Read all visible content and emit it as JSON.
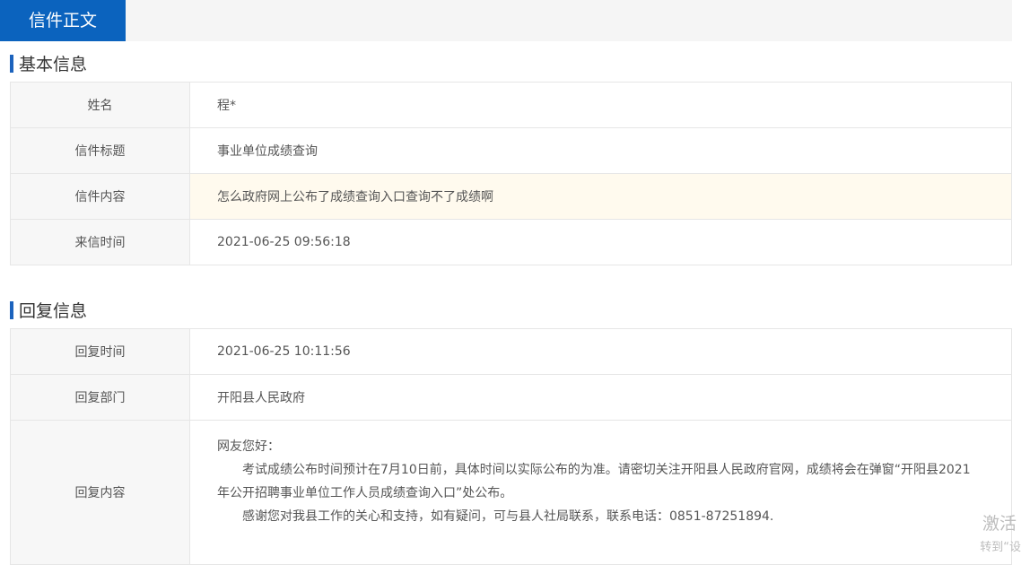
{
  "tab": {
    "label": "信件正文"
  },
  "basic": {
    "title": "基本信息",
    "rows": [
      {
        "label": "姓名",
        "value": "程*"
      },
      {
        "label": "信件标题",
        "value": "事业单位成绩查询"
      },
      {
        "label": "信件内容",
        "value": "怎么政府网上公布了成绩查询入口查询不了成绩啊"
      },
      {
        "label": "来信时间",
        "value": "2021-06-25 09:56:18"
      }
    ]
  },
  "reply": {
    "title": "回复信息",
    "rows": [
      {
        "label": "回复时间",
        "value": "2021-06-25 10:11:56"
      },
      {
        "label": "回复部门",
        "value": "开阳县人民政府"
      }
    ],
    "content_label": "回复内容",
    "content_lines": [
      "网友您好：",
      "考试成绩公布时间预计在7月10日前，具体时间以实际公布的为准。请密切关注开阳县人民政府官网，成绩将会在弹窗“开阳县2021年公开招聘事业单位工作人员成绩查询入口”处公布。",
      "感谢您对我县工作的关心和支持，如有疑问，可与县人社局联系，联系电话：0851-87251894."
    ]
  },
  "watermark": {
    "line1": "激活",
    "line2": "转到“设"
  }
}
